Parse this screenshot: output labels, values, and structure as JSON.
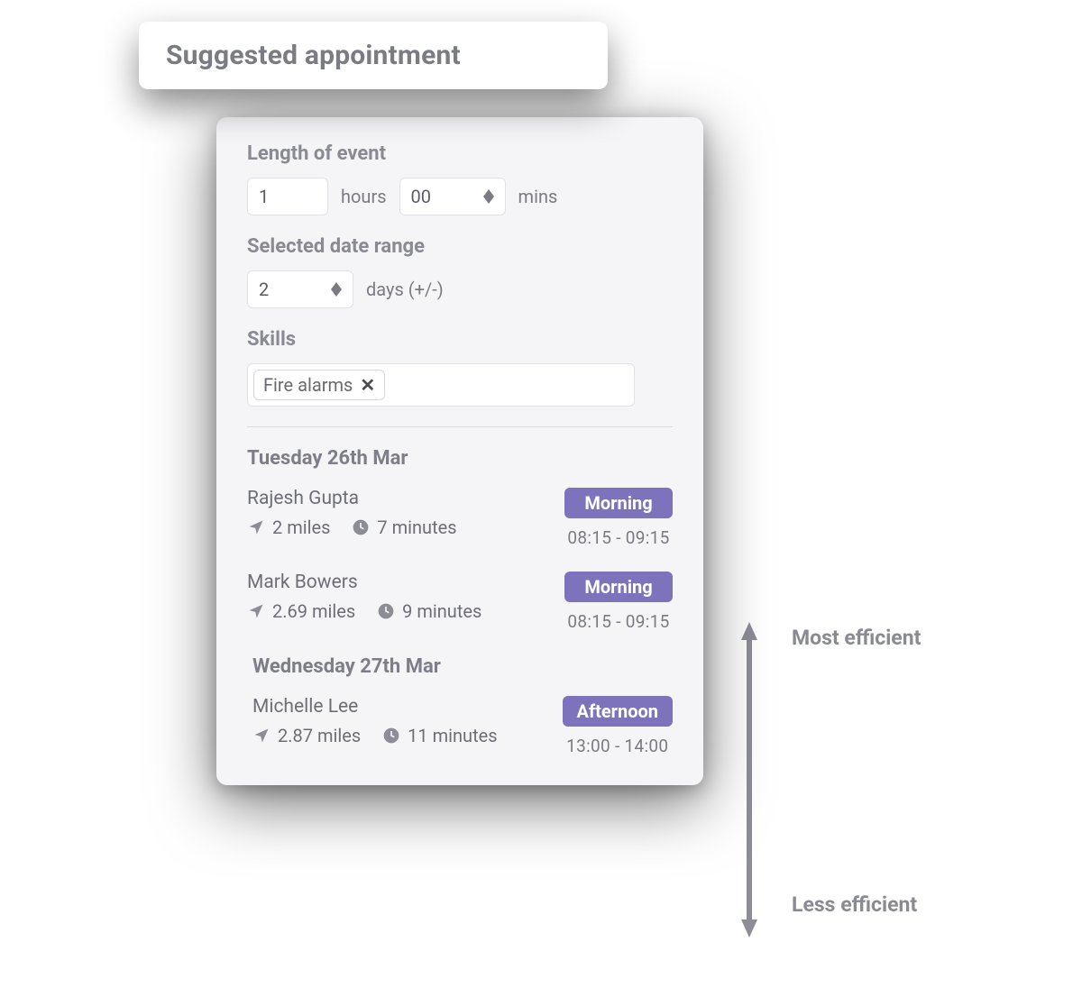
{
  "title": "Suggested appointment",
  "sections": {
    "length_label": "Length of event",
    "hours_value": "1",
    "hours_unit": "hours",
    "mins_value": "00",
    "mins_unit": "mins",
    "daterange_label": "Selected date range",
    "days_value": "2",
    "days_unit": "days (+/-)",
    "skills_label": "Skills",
    "skill_tag": "Fire alarms"
  },
  "days": [
    {
      "heading": "Tuesday 26th Mar",
      "slots": [
        {
          "name": "Rajesh Gupta",
          "distance": "2 miles",
          "duration": "7 minutes",
          "badge": "Morning",
          "time": "08:15 - 09:15"
        },
        {
          "name": "Mark Bowers",
          "distance": "2.69 miles",
          "duration": "9 minutes",
          "badge": "Morning",
          "time": "08:15 - 09:15"
        }
      ]
    },
    {
      "heading": "Wednesday 27th Mar",
      "slots": [
        {
          "name": "Michelle Lee",
          "distance": "2.87 miles",
          "duration": "11 minutes",
          "badge": "Afternoon",
          "time": "13:00 - 14:00"
        }
      ]
    }
  ],
  "efficiency": {
    "top": "Most efficient",
    "bottom": "Less efficient"
  }
}
